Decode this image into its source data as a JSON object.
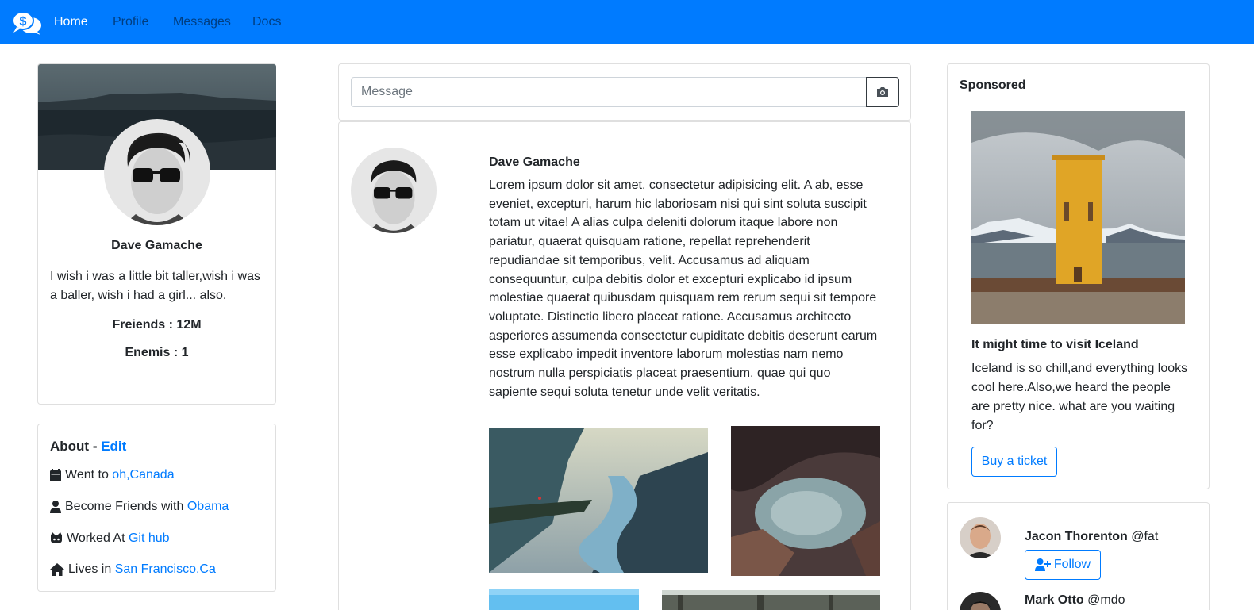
{
  "nav": {
    "brand_icon": "chat-dollar-icon",
    "links": [
      {
        "label": "Home",
        "active": true
      },
      {
        "label": "Profile",
        "active": false
      },
      {
        "label": "Messages",
        "active": false
      },
      {
        "label": "Docs",
        "active": false
      }
    ]
  },
  "profile": {
    "name": "Dave Gamache",
    "bio": "I wish i was a little bit taller,wish i was a baller, wish i had a girl... also.",
    "friends": "Freiends : 12M",
    "enemies": "Enemis : 1"
  },
  "about": {
    "title": "About - ",
    "edit": "Edit",
    "items": [
      {
        "icon": "calendar-icon",
        "text": "Went to ",
        "link": "oh,Canada"
      },
      {
        "icon": "user-icon",
        "text": "Become Friends with ",
        "link": "Obama"
      },
      {
        "icon": "github-icon",
        "text": "Worked At ",
        "link": "Git hub"
      },
      {
        "icon": "home-icon",
        "text": "Lives in ",
        "link": "San Francisco,Ca"
      }
    ]
  },
  "composer": {
    "placeholder": "Message",
    "camera_icon": "camera-icon"
  },
  "post": {
    "author": "Dave Gamache",
    "body": "Lorem ipsum dolor sit amet, consectetur adipisicing elit. A ab, esse eveniet, excepturi, harum hic laboriosam nisi qui sint soluta suscipit totam ut vitae! A alias culpa deleniti dolorum itaque labore non pariatur, quaerat quisquam ratione, repellat reprehenderit repudiandae sit temporibus, velit. Accusamus ad aliquam consequuntur, culpa debitis dolor et excepturi explicabo id ipsum molestiae quaerat quibusdam quisquam rem rerum sequi sit tempore voluptate. Distinctio libero placeat ratione. Accusamus architecto asperiores assumenda consectetur cupiditate debitis deserunt earum esse explicabo impedit inventore laborum molestias nam nemo nostrum nulla perspiciatis placeat praesentium, quae qui quo sapiente sequi soluta tenetur unde velit veritatis."
  },
  "sponsored": {
    "title": "Sponsored",
    "ad_title": "It might time to visit Iceland",
    "ad_text": "Iceland is so chill,and everything looks cool here.Also,we heard the people are pretty nice. what are you waiting for?",
    "button": "Buy a ticket"
  },
  "suggestions": [
    {
      "name": "Jacon Thorenton",
      "handle": " @fat",
      "button": "Follow"
    },
    {
      "name": "Mark Otto",
      "handle": " @mdo"
    }
  ],
  "colors": {
    "primary": "#007bff",
    "text": "#212529",
    "border": "rgba(0,0,0,0.125)"
  }
}
